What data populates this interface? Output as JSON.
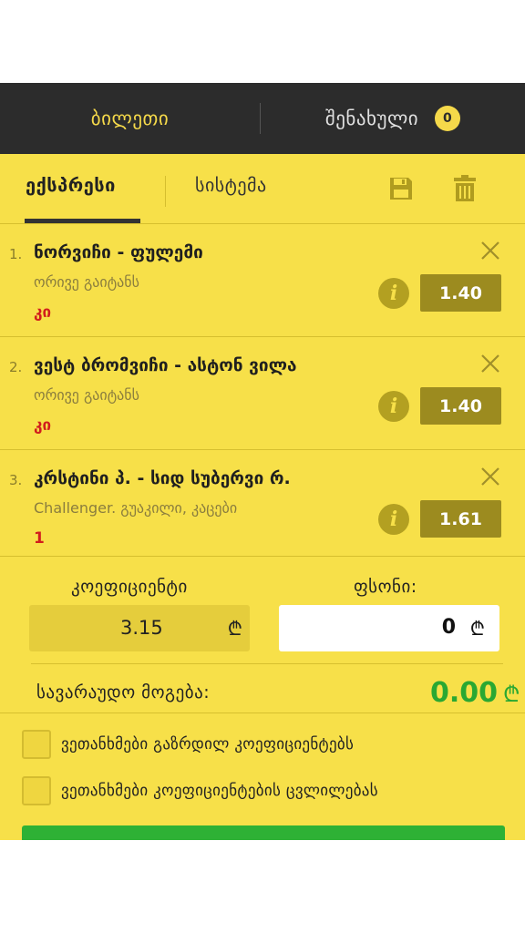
{
  "header": {
    "ticket_label": "ბილეთი",
    "saved_label": "შენახული",
    "saved_count": "0"
  },
  "subtabs": {
    "express_label": "ექსპრესი",
    "system_label": "სისტემა"
  },
  "bets": [
    {
      "num": "1.",
      "title": "ნორვიჩი - ფულემი",
      "market": "ორივე გაიტანს",
      "pick": "კი",
      "odd": "1.40"
    },
    {
      "num": "2.",
      "title": "ვესტ ბრომვიჩი - ასტონ ვილა",
      "market": "ორივე გაიტანს",
      "pick": "კი",
      "odd": "1.40"
    },
    {
      "num": "3.",
      "title": "კრსტინი პ. - სიდ სუბერვი რ.",
      "market": "Challenger. გუაკილი, კაცები",
      "pick": "1",
      "odd": "1.61"
    }
  ],
  "summary": {
    "coef_label": "კოეფიციენტი",
    "coef_value": "3.15",
    "stake_label": "ფსონი:",
    "stake_value": "0",
    "currency": "₾",
    "win_label": "სავარაუდო მოგება:",
    "win_value": "0.00"
  },
  "checks": {
    "increased_odds": "ვეთანხმები გაზრდილ კოეფიციენტებს",
    "odds_change": "ვეთანხმები კოეფიციენტების ცვლილებას"
  },
  "colors": {
    "header_bg": "#2c2c2c",
    "accent_yellow": "#f7e049",
    "odd_bg": "#9c8b1f",
    "win_green": "#2aa832",
    "pick_red": "#d11d1d"
  }
}
